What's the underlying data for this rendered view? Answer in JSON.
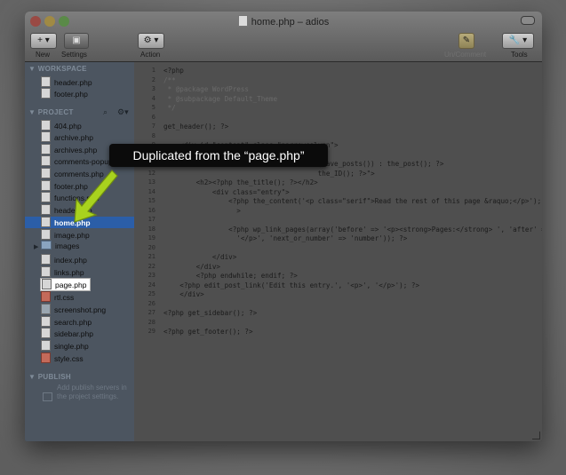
{
  "window": {
    "title": "home.php – adios"
  },
  "toolbar": {
    "new_label": "New",
    "settings_label": "Settings",
    "action_label": "Action",
    "uncomment_label": "Un/Comment",
    "tools_label": "Tools",
    "new_button_glyph": "+ ▾",
    "action_button_glyph": "⚙ ▾",
    "tools_button_glyph": "🔧 ▾"
  },
  "sidebar": {
    "workspace_header": "▼ WORKSPACE",
    "workspace_items": [
      "header.php",
      "footer.php"
    ],
    "project_header": "▼ PROJECT",
    "project_items": [
      {
        "name": "404.php",
        "type": "php"
      },
      {
        "name": "archive.php",
        "type": "php"
      },
      {
        "name": "archives.php",
        "type": "php"
      },
      {
        "name": "comments-popup.php",
        "type": "php"
      },
      {
        "name": "comments.php",
        "type": "php"
      },
      {
        "name": "footer.php",
        "type": "php"
      },
      {
        "name": "functions.php",
        "type": "php"
      },
      {
        "name": "header.php",
        "type": "php"
      },
      {
        "name": "home.php",
        "type": "php",
        "selected": true
      },
      {
        "name": "image.php",
        "type": "php"
      },
      {
        "name": "images",
        "type": "folder"
      },
      {
        "name": "index.php",
        "type": "php"
      },
      {
        "name": "links.php",
        "type": "php"
      },
      {
        "name": "page.php",
        "type": "php",
        "highlighted": true
      },
      {
        "name": "rtl.css",
        "type": "css"
      },
      {
        "name": "screenshot.png",
        "type": "png"
      },
      {
        "name": "search.php",
        "type": "php"
      },
      {
        "name": "sidebar.php",
        "type": "php"
      },
      {
        "name": "single.php",
        "type": "php"
      },
      {
        "name": "style.css",
        "type": "css"
      }
    ],
    "publish_header": "▼ PUBLISH",
    "publish_note": "Add publish servers in the project settings."
  },
  "editor": {
    "lines": [
      {
        "n": "1",
        "text": "<?php"
      },
      {
        "n": "2",
        "text": "/**"
      },
      {
        "n": "3",
        "text": " * @package WordPress"
      },
      {
        "n": "4",
        "text": " * @subpackage Default_Theme"
      },
      {
        "n": "5",
        "text": " */"
      },
      {
        "n": "6",
        "text": ""
      },
      {
        "n": "7",
        "text": "get_header(); ?>"
      },
      {
        "n": "8",
        "text": ""
      },
      {
        "n": "9",
        "text": "    <div id=\"content\" class=\"narrowcolumn\">"
      },
      {
        "n": "10",
        "text": ""
      },
      {
        "n": "11",
        "text": "                                      (have_posts()) : the_post(); ?>"
      },
      {
        "n": "12",
        "text": "                                      the_ID(); ?>\">"
      },
      {
        "n": "13",
        "text": "        <h2><?php the_title(); ?></h2>"
      },
      {
        "n": "14",
        "text": "            <div class=\"entry\">"
      },
      {
        "n": "15",
        "text": "                <?php the_content('<p class=\"serif\">Read the rest of this page &raquo;</p>'); ?"
      },
      {
        "n": "16",
        "text": "                  >"
      },
      {
        "n": "17",
        "text": ""
      },
      {
        "n": "18",
        "text": "                <?php wp_link_pages(array('before' => '<p><strong>Pages:</strong> ', 'after' =>"
      },
      {
        "n": "19",
        "text": "                  '</p>', 'next_or_number' => 'number')); ?>"
      },
      {
        "n": "20",
        "text": ""
      },
      {
        "n": "21",
        "text": "            </div>"
      },
      {
        "n": "22",
        "text": "        </div>"
      },
      {
        "n": "23",
        "text": "        <?php endwhile; endif; ?>"
      },
      {
        "n": "24",
        "text": "    <?php edit_post_link('Edit this entry.', '<p>', '</p>'); ?>"
      },
      {
        "n": "25",
        "text": "    </div>"
      },
      {
        "n": "26",
        "text": ""
      },
      {
        "n": "27",
        "text": "<?php get_sidebar(); ?>"
      },
      {
        "n": "28",
        "text": ""
      },
      {
        "n": "29",
        "text": "<?php get_footer(); ?>"
      }
    ]
  },
  "callout": {
    "text": "Duplicated from the “page.php”"
  },
  "colors": {
    "selection": "#2b5ea8",
    "arrow": "#a8d21e",
    "tooltip_bg": "#0b0b0b"
  }
}
